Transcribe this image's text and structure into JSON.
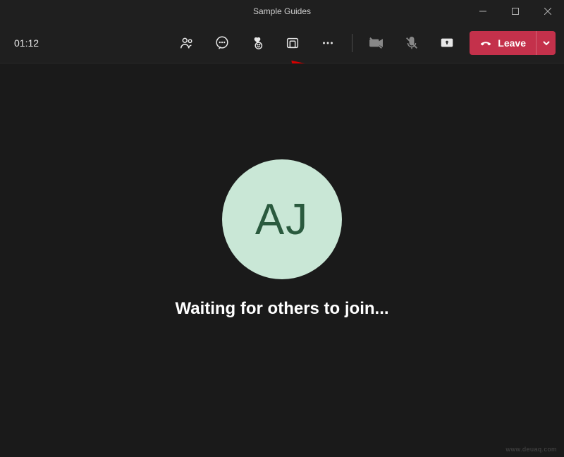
{
  "window": {
    "title": "Sample Guides"
  },
  "toolbar": {
    "timer": "01:12",
    "leave_label": "Leave"
  },
  "main": {
    "avatar_initials": "AJ",
    "waiting_text": "Waiting for others to join..."
  },
  "watermark": "www.deuaq.com",
  "colors": {
    "leave_bg": "#c4314b",
    "avatar_bg": "#c9e7d6",
    "avatar_fg": "#2a5a3e",
    "arrow": "#d40000"
  }
}
